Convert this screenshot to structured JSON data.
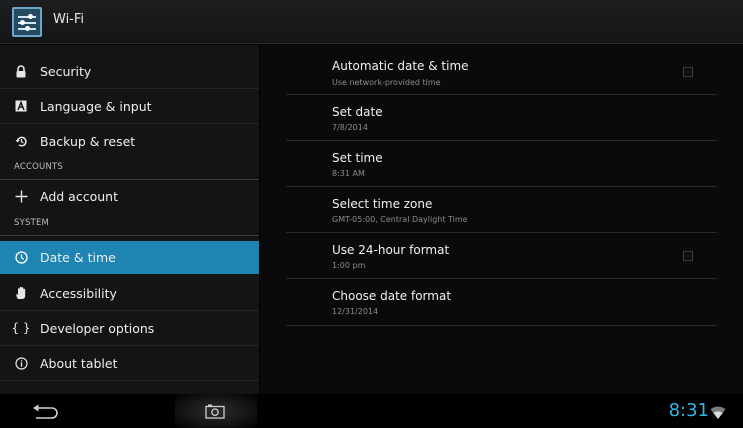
{
  "actionbar": {
    "title": "Wi-Fi",
    "icon": "settings-sliders-icon"
  },
  "sidebar": {
    "items": [
      {
        "label": "Security",
        "icon": "lock-icon",
        "type": "item"
      },
      {
        "label": "Language & input",
        "icon": "keyboard-icon",
        "type": "item"
      },
      {
        "label": "Backup & reset",
        "icon": "backup-icon",
        "type": "item"
      },
      {
        "label": "ACCOUNTS",
        "type": "header"
      },
      {
        "label": "Add account",
        "icon": "plus-icon",
        "type": "item"
      },
      {
        "label": "SYSTEM",
        "type": "header"
      },
      {
        "label": "Date & time",
        "icon": "clock-icon",
        "type": "item",
        "selected": true
      },
      {
        "label": "Accessibility",
        "icon": "hand-icon",
        "type": "item"
      },
      {
        "label": "Developer options",
        "icon": "braces-icon",
        "type": "item"
      },
      {
        "label": "About tablet",
        "icon": "info-icon",
        "type": "item"
      }
    ]
  },
  "prefs": [
    {
      "title": "Automatic date & time",
      "summary": "Use network-provided time",
      "checkbox": true,
      "checked": false
    },
    {
      "title": "Set date",
      "summary": "7/8/2014"
    },
    {
      "title": "Set time",
      "summary": "8:31 AM"
    },
    {
      "title": "Select time zone",
      "summary": "GMT-05:00, Central Daylight Time"
    },
    {
      "title": "Use 24-hour format",
      "summary": "1:00 pm",
      "checkbox": true,
      "checked": false
    },
    {
      "title": "Choose date format",
      "summary": "12/31/2014"
    }
  ],
  "statusbar": {
    "time": "8:31",
    "icons": [
      "back-icon",
      "camera-icon",
      "wifi-icon"
    ]
  },
  "colors": {
    "accent": "#33b5e5",
    "selected": "#1e84b2",
    "background": "#000000"
  }
}
